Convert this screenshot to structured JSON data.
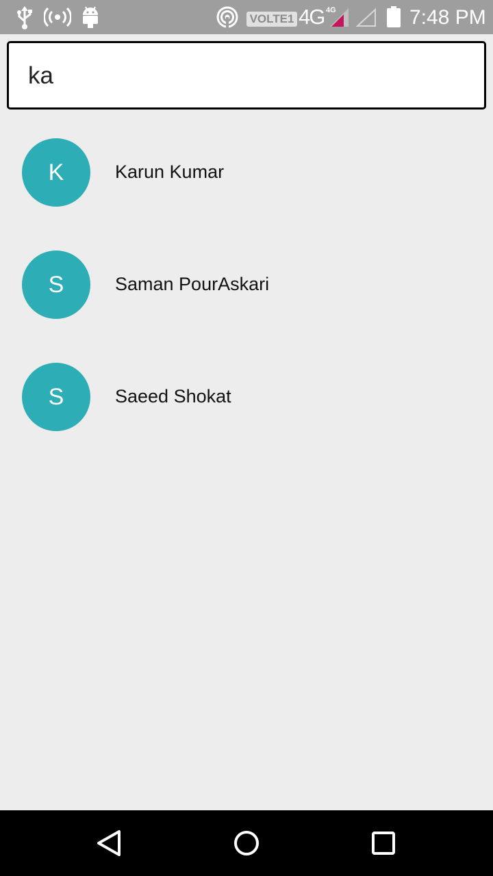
{
  "status_bar": {
    "icons": [
      "usb-icon",
      "hotspot-icon",
      "android-icon",
      "wifi-icon",
      "signal-icon",
      "battery-icon"
    ],
    "volte_label": "VOLTE1",
    "network_label": "4G",
    "network_small_label": "4G",
    "time": "7:48 PM"
  },
  "search": {
    "value": "ka",
    "border_color": "#000000"
  },
  "contacts": [
    {
      "initial": "K",
      "name": "Karun Kumar"
    },
    {
      "initial": "S",
      "name": "Saman PourAskari"
    },
    {
      "initial": "S",
      "name": "Saeed Shokat"
    }
  ],
  "avatar_color": "#2dadb5",
  "nav_bar": {
    "icons": [
      "back-icon",
      "home-icon",
      "recent-apps-icon"
    ]
  }
}
